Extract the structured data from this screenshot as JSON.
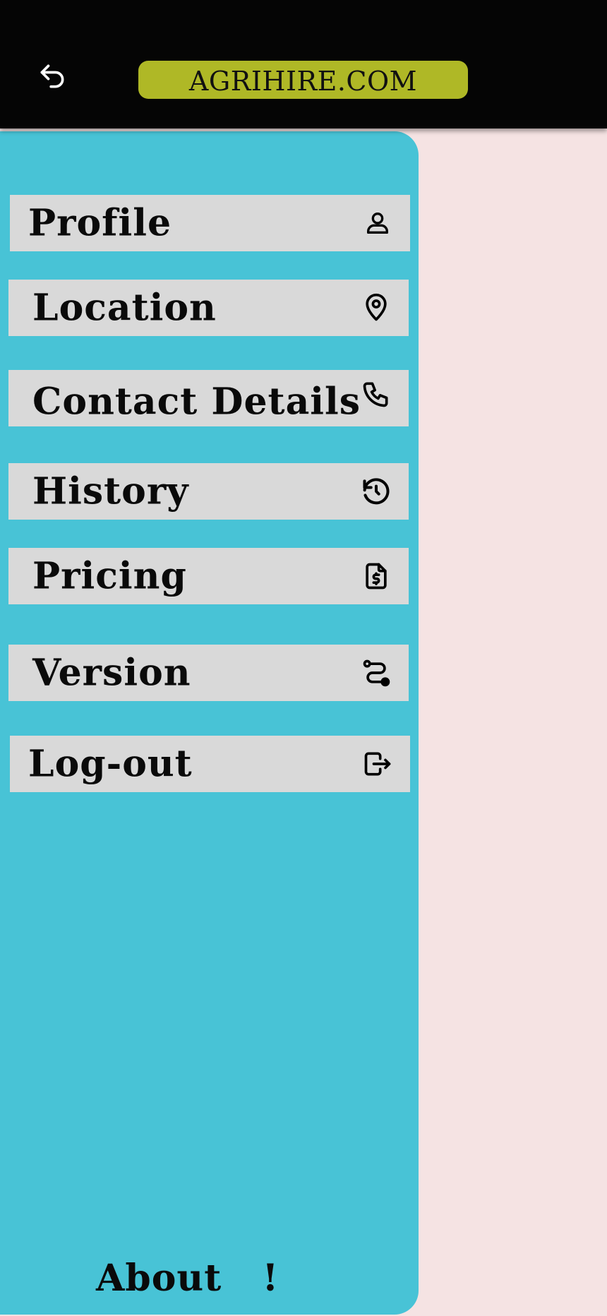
{
  "header": {
    "brand": "AGRIHIRE.COM",
    "back_icon": "undo-arrow-icon"
  },
  "drawer": {
    "items": [
      {
        "label": "Profile",
        "icon": "user-icon"
      },
      {
        "label": "Location",
        "icon": "map-pin-icon"
      },
      {
        "label": "Contact  Details",
        "icon": "phone-icon"
      },
      {
        "label": "History",
        "icon": "history-icon"
      },
      {
        "label": "Pricing",
        "icon": "invoice-dollar-icon"
      },
      {
        "label": "Version",
        "icon": "route-icon"
      },
      {
        "label": "Log-out",
        "icon": "logout-icon"
      }
    ],
    "about": "About   !"
  },
  "colors": {
    "topbar": "#050505",
    "brand_bg": "#afb826",
    "drawer_bg": "#48c3d6",
    "item_bg": "#d9d9d9",
    "page_bg": "#f5e3e3"
  }
}
